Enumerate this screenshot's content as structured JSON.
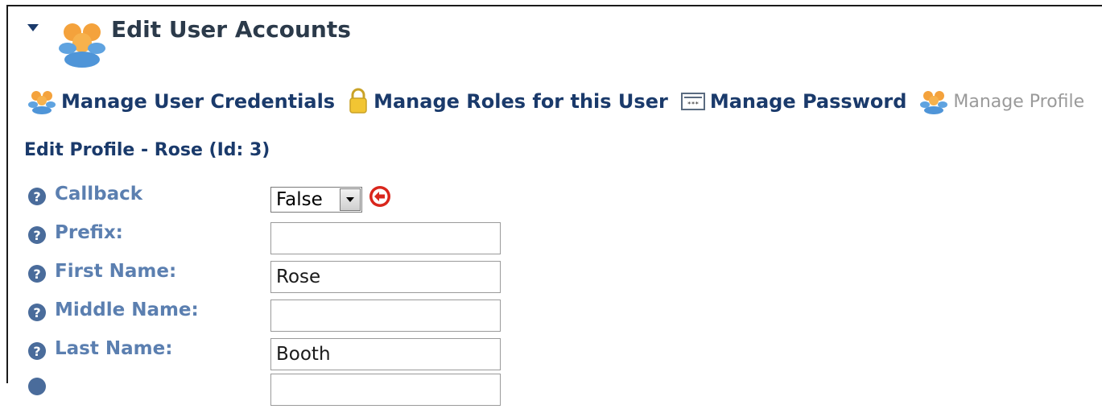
{
  "header": {
    "title": "Edit User Accounts",
    "collapse_icon": "collapse-arrow-icon",
    "module_icon": "users-group-icon"
  },
  "actions": [
    {
      "label": "Manage User Credentials",
      "icon": "users-icon",
      "enabled": true
    },
    {
      "label": "Manage Roles for this User",
      "icon": "lock-icon",
      "enabled": true
    },
    {
      "label": "Manage Password",
      "icon": "password-field-icon",
      "enabled": true
    },
    {
      "label": "Manage Profile",
      "icon": "users-icon",
      "enabled": false
    }
  ],
  "section": {
    "title": "Edit Profile - Rose (Id: 3)"
  },
  "form": {
    "callback": {
      "label": "Callback",
      "selected": "False"
    },
    "prefix": {
      "label": "Prefix:",
      "value": ""
    },
    "first_name": {
      "label": "First Name:",
      "value": "Rose"
    },
    "middle_name": {
      "label": "Middle Name:",
      "value": ""
    },
    "last_name": {
      "label": "Last Name:",
      "value": "Booth"
    }
  },
  "colors": {
    "link": "#1a3a6b",
    "label": "#5b7fb0",
    "disabled": "#9a9a9a",
    "undo": "#d9261c"
  }
}
